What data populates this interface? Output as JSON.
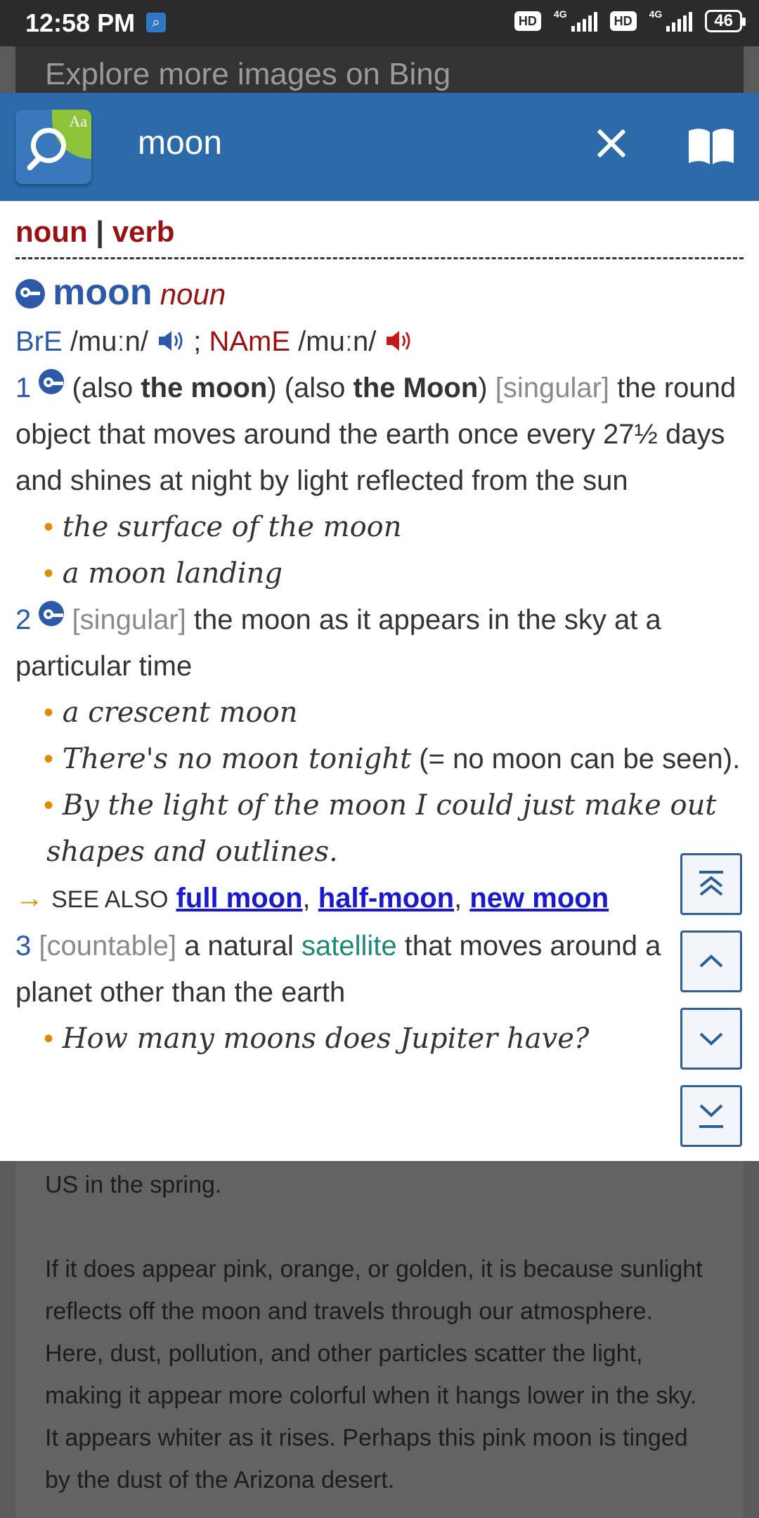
{
  "status_bar": {
    "time": "12:58 PM",
    "hd1": "HD",
    "net1": "4G",
    "hd2": "HD",
    "net2": "4G",
    "battery": "46"
  },
  "background": {
    "bing_banner": "Explore more images on Bing",
    "article_line1": "US in the spring.",
    "article_para2": "If it does appear pink, orange, or golden, it is because sunlight reflects off the moon and travels through our atmosphere. Here, dust, pollution, and other particles scatter the light, making it appear more colorful when it hangs lower in the sky. It appears whiter as it rises. Perhaps this pink moon is tinged by the dust of the Arizona desert."
  },
  "header": {
    "search_word": "moon",
    "logo_text": "Aa"
  },
  "entry": {
    "pos_tabs": [
      "noun",
      "verb"
    ],
    "separator": "|",
    "headword": "moon",
    "headword_pos": "noun",
    "pron_bre_label": "BrE",
    "pron_bre": "/muːn/",
    "pron_sep": ";",
    "pron_name_label": "NAmE",
    "pron_name": "/muːn/",
    "senses": [
      {
        "num": "1",
        "parts": [
          "(also ",
          "the moon",
          ") (also ",
          "the Moon",
          ") "
        ],
        "label": "[singular]",
        "definition": " the round object that moves around the earth once every 27½ days and shines at night by light reflected from the sun",
        "examples": [
          "the surface of the moon",
          "a moon landing"
        ]
      },
      {
        "num": "2",
        "label": "[singular]",
        "definition": " the moon as it appears in the sky at a particular time",
        "examples": [
          "a crescent moon",
          "There's no moon tonight",
          "By the light of the moon I could just make out shapes and outlines."
        ],
        "example2_gloss": " (= no moon can be seen)."
      },
      {
        "num": "3",
        "label": "[countable]",
        "definition_pre": " a natural ",
        "definition_link": "satellite",
        "definition_post": " that moves around a planet other than the earth",
        "examples": [
          "How many moons does Jupiter have?"
        ]
      }
    ],
    "see_also_arrow": "→",
    "see_also_label": "SEE ALSO",
    "see_also_links": [
      "full moon",
      "half-moon",
      "new moon"
    ],
    "comma": ","
  },
  "icons": {
    "key": "oxford-key-icon",
    "speaker_bre": "speaker-blue-icon",
    "speaker_name": "speaker-red-icon",
    "close": "close-icon",
    "book": "book-icon",
    "scroll_top": "scroll-top-icon",
    "scroll_up": "scroll-up-icon",
    "scroll_down": "scroll-down-icon",
    "scroll_bottom": "scroll-bottom-icon"
  },
  "colors": {
    "header_blue": "#2c6aaa",
    "headword_blue": "#2c5aa8",
    "pos_red": "#9a1111",
    "bullet_orange": "#e08a00",
    "link_blue": "#1a1acc",
    "satellite_green": "#1a8a74"
  }
}
